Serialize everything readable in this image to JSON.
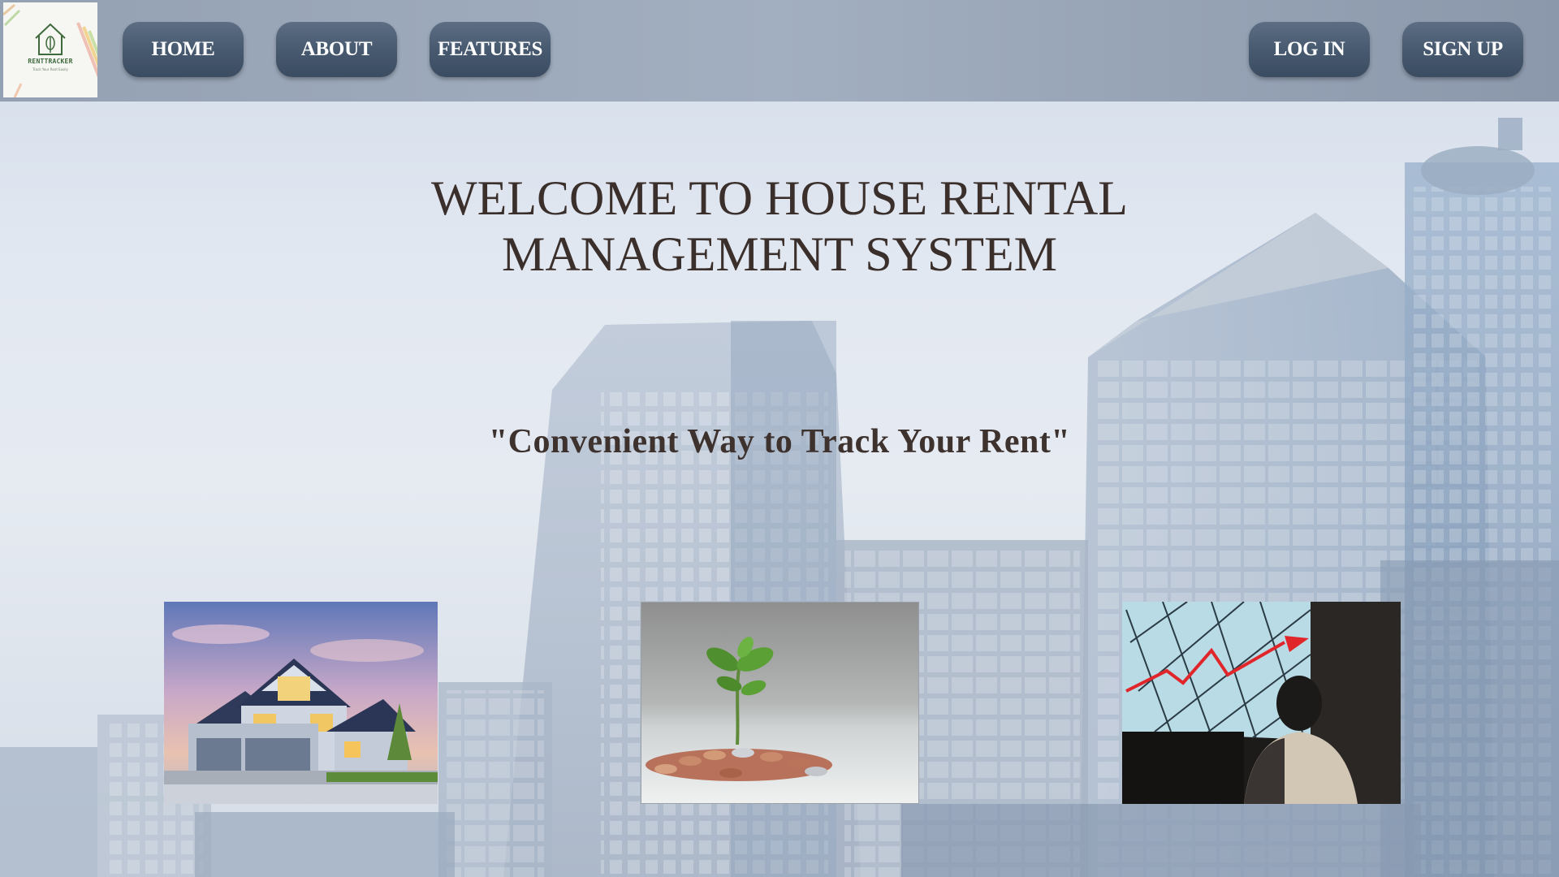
{
  "logo": {
    "name": "RENTTRACKER",
    "tagline": "Track Your Rent Easily"
  },
  "nav": {
    "left": [
      {
        "label": "HOME"
      },
      {
        "label": "ABOUT"
      },
      {
        "label": "FEATURES"
      }
    ],
    "right": [
      {
        "label": "LOG IN"
      },
      {
        "label": "SIGN UP"
      }
    ]
  },
  "hero": {
    "title_line1": "WELCOME TO HOUSE RENTAL",
    "title_line2": "MANAGEMENT SYSTEM",
    "tagline": "\"Convenient Way to Track Your Rent\""
  },
  "colors": {
    "nav_button": "#485a70",
    "heading": "#3b2f2b",
    "navbar": "#9aa7b8"
  },
  "images": [
    {
      "subject": "house-photo"
    },
    {
      "subject": "plant-on-coins-photo"
    },
    {
      "subject": "growth-chart-presentation-photo"
    }
  ]
}
